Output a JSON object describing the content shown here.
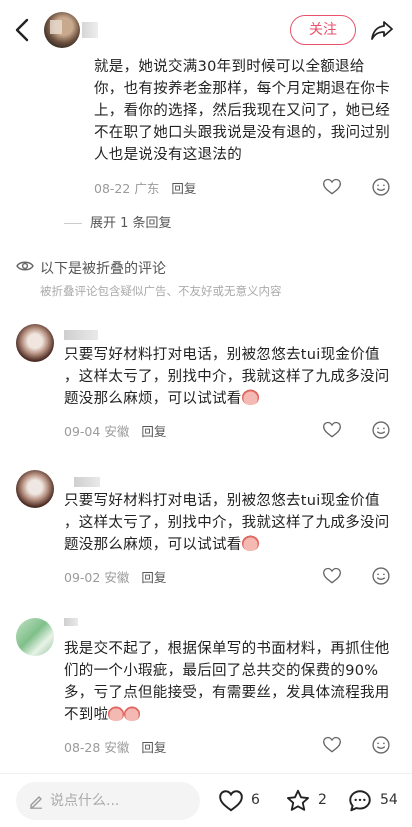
{
  "header": {
    "follow_label": "关注"
  },
  "comment1": {
    "text": "就是，她说交满30年到时候可以全额退给你，也有按养老金那样，每个月定期退在你卡上，看你的选择，然后我现在又问了，她已经不在职了她口头跟我说是没有退的，我问过别人也是说没有这退法的",
    "date": "08-22",
    "location": "广东",
    "reply_label": "回复",
    "expand_label": "展开 1 条回复"
  },
  "folded": {
    "title": "以下是被折叠的评论",
    "subtitle": "被折叠评论包含疑似广告、不友好或无意义内容"
  },
  "comment2": {
    "text": "只要写好材料打对电话，别被忽悠去tui现金价值 ，这样太亏了，别找中介，我就这样了九成多没问题没那么麻烦，可以试试看",
    "date": "09-04",
    "location": "安徽",
    "reply_label": "回复"
  },
  "comment3": {
    "text": "只要写好材料打对电话，别被忽悠去tui现金价值 ，这样太亏了，别找中介，我就这样了九成多没问题没那么麻烦，可以试试看",
    "date": "09-02",
    "location": "安徽",
    "reply_label": "回复"
  },
  "comment4": {
    "text": "我是交不起了，根据保单写的书面材料，再抓住他们的一个小瑕疵，最后回了总共交的保费的90%多，亏了点但能接受，有需要丝，发具体流程我用不到啦",
    "date": "08-28",
    "location": "安徽",
    "reply_label": "回复"
  },
  "bottom_bar": {
    "input_placeholder": "说点什么...",
    "likes": "6",
    "stars": "2",
    "comments": "54"
  },
  "colors": {
    "accent": "#e8526a",
    "meta": "#9a9a9a"
  },
  "icons": [
    "back-icon",
    "share-icon",
    "heart-icon",
    "smile-icon",
    "eye-icon",
    "pen-icon",
    "star-icon",
    "comment-icon"
  ]
}
